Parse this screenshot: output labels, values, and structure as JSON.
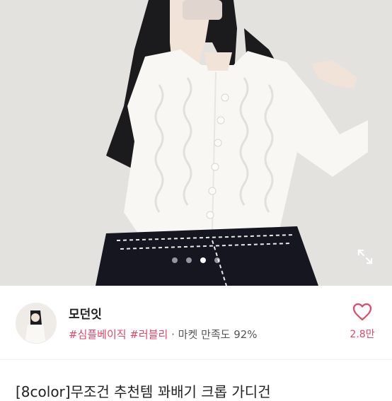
{
  "product": {
    "image_alt": "white cable-knit cropped cardigan",
    "carousel": {
      "total": 4,
      "active": 3
    },
    "expand_icon": "expand-icon",
    "title": "[8color]무조건 추천템 꽈배기 크롭 가디건"
  },
  "shop": {
    "name": "모던잇",
    "tags": "#심플베이직 #러블리",
    "separator": "·",
    "satisfaction": "마켓 만족도 92%",
    "likes": "2.8만",
    "heart_icon": "heart-icon"
  },
  "colors": {
    "accent": "#e2466a"
  }
}
